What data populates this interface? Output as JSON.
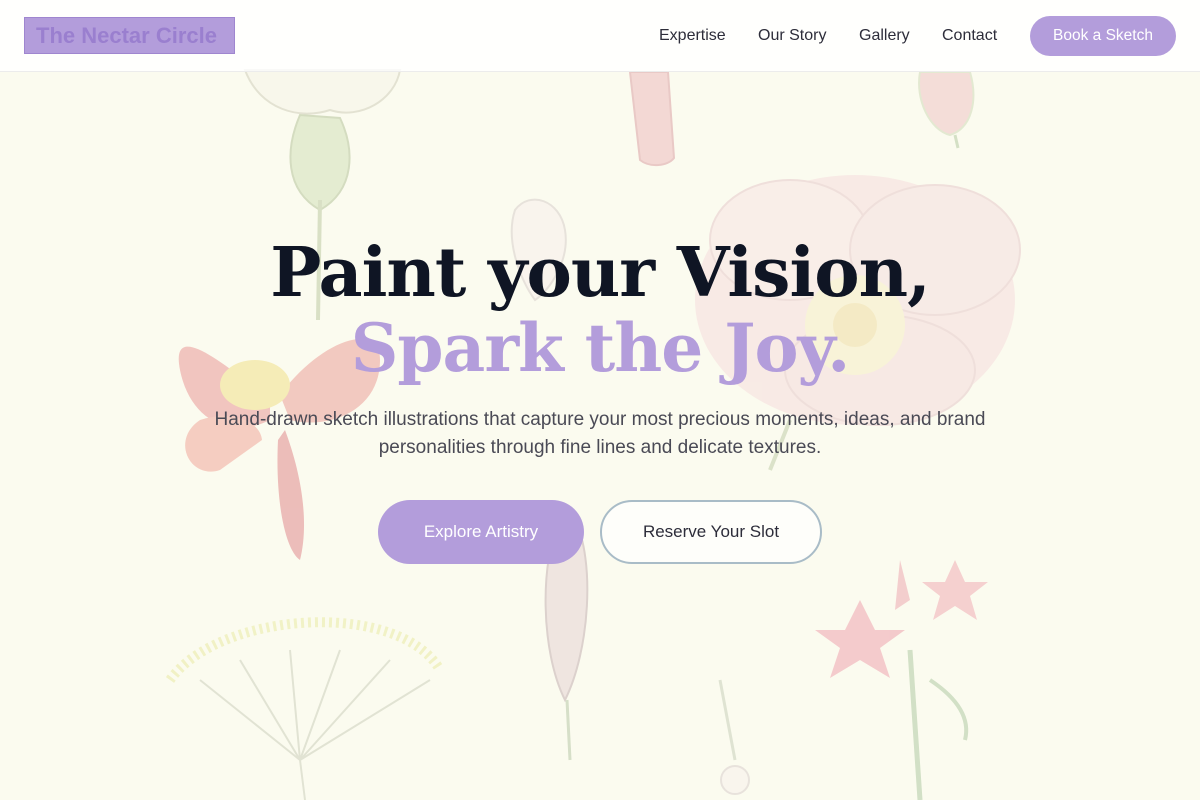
{
  "header": {
    "logo_text": "The Nectar Circle",
    "nav": [
      {
        "label": "Expertise"
      },
      {
        "label": "Our Story"
      },
      {
        "label": "Gallery"
      },
      {
        "label": "Contact"
      }
    ],
    "cta_label": "Book a Sketch"
  },
  "hero": {
    "headline_line1": "Paint your Vision,",
    "headline_line2": "Spark the Joy.",
    "subtext": "Hand-drawn sketch illustrations that capture your most precious moments, ideas, and brand personalities through fine lines and delicate textures.",
    "primary_button": "Explore Artistry",
    "secondary_button": "Reserve Your Slot"
  },
  "colors": {
    "accent": "#b39ddb",
    "heading": "#0f1524",
    "background": "#fbfbef",
    "outline": "#a9bcc7"
  },
  "background_image": "botanical-flower-illustrations"
}
